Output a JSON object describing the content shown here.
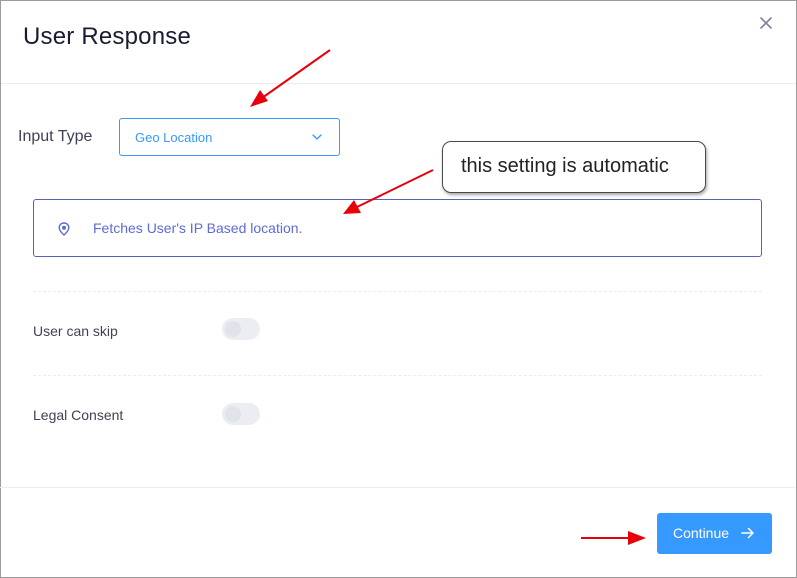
{
  "modal": {
    "title": "User Response",
    "close_icon": "close-icon"
  },
  "input_type": {
    "label": "Input Type",
    "selected_value": "Geo Location",
    "chevron_icon": "chevron-down-icon"
  },
  "info_box": {
    "icon": "location-pin-icon",
    "text": "Fetches User's IP Based location."
  },
  "settings": [
    {
      "label": "User can skip",
      "enabled": false
    },
    {
      "label": "Legal Consent",
      "enabled": false
    }
  ],
  "footer": {
    "continue_label": "Continue",
    "continue_icon": "arrow-right-icon"
  },
  "annotation": {
    "callout_text": "this setting is automatic",
    "arrow_color": "#e8000b"
  },
  "colors": {
    "accent": "#3699ff",
    "info_text": "#5d6bd3",
    "info_border": "#5a62b5"
  }
}
